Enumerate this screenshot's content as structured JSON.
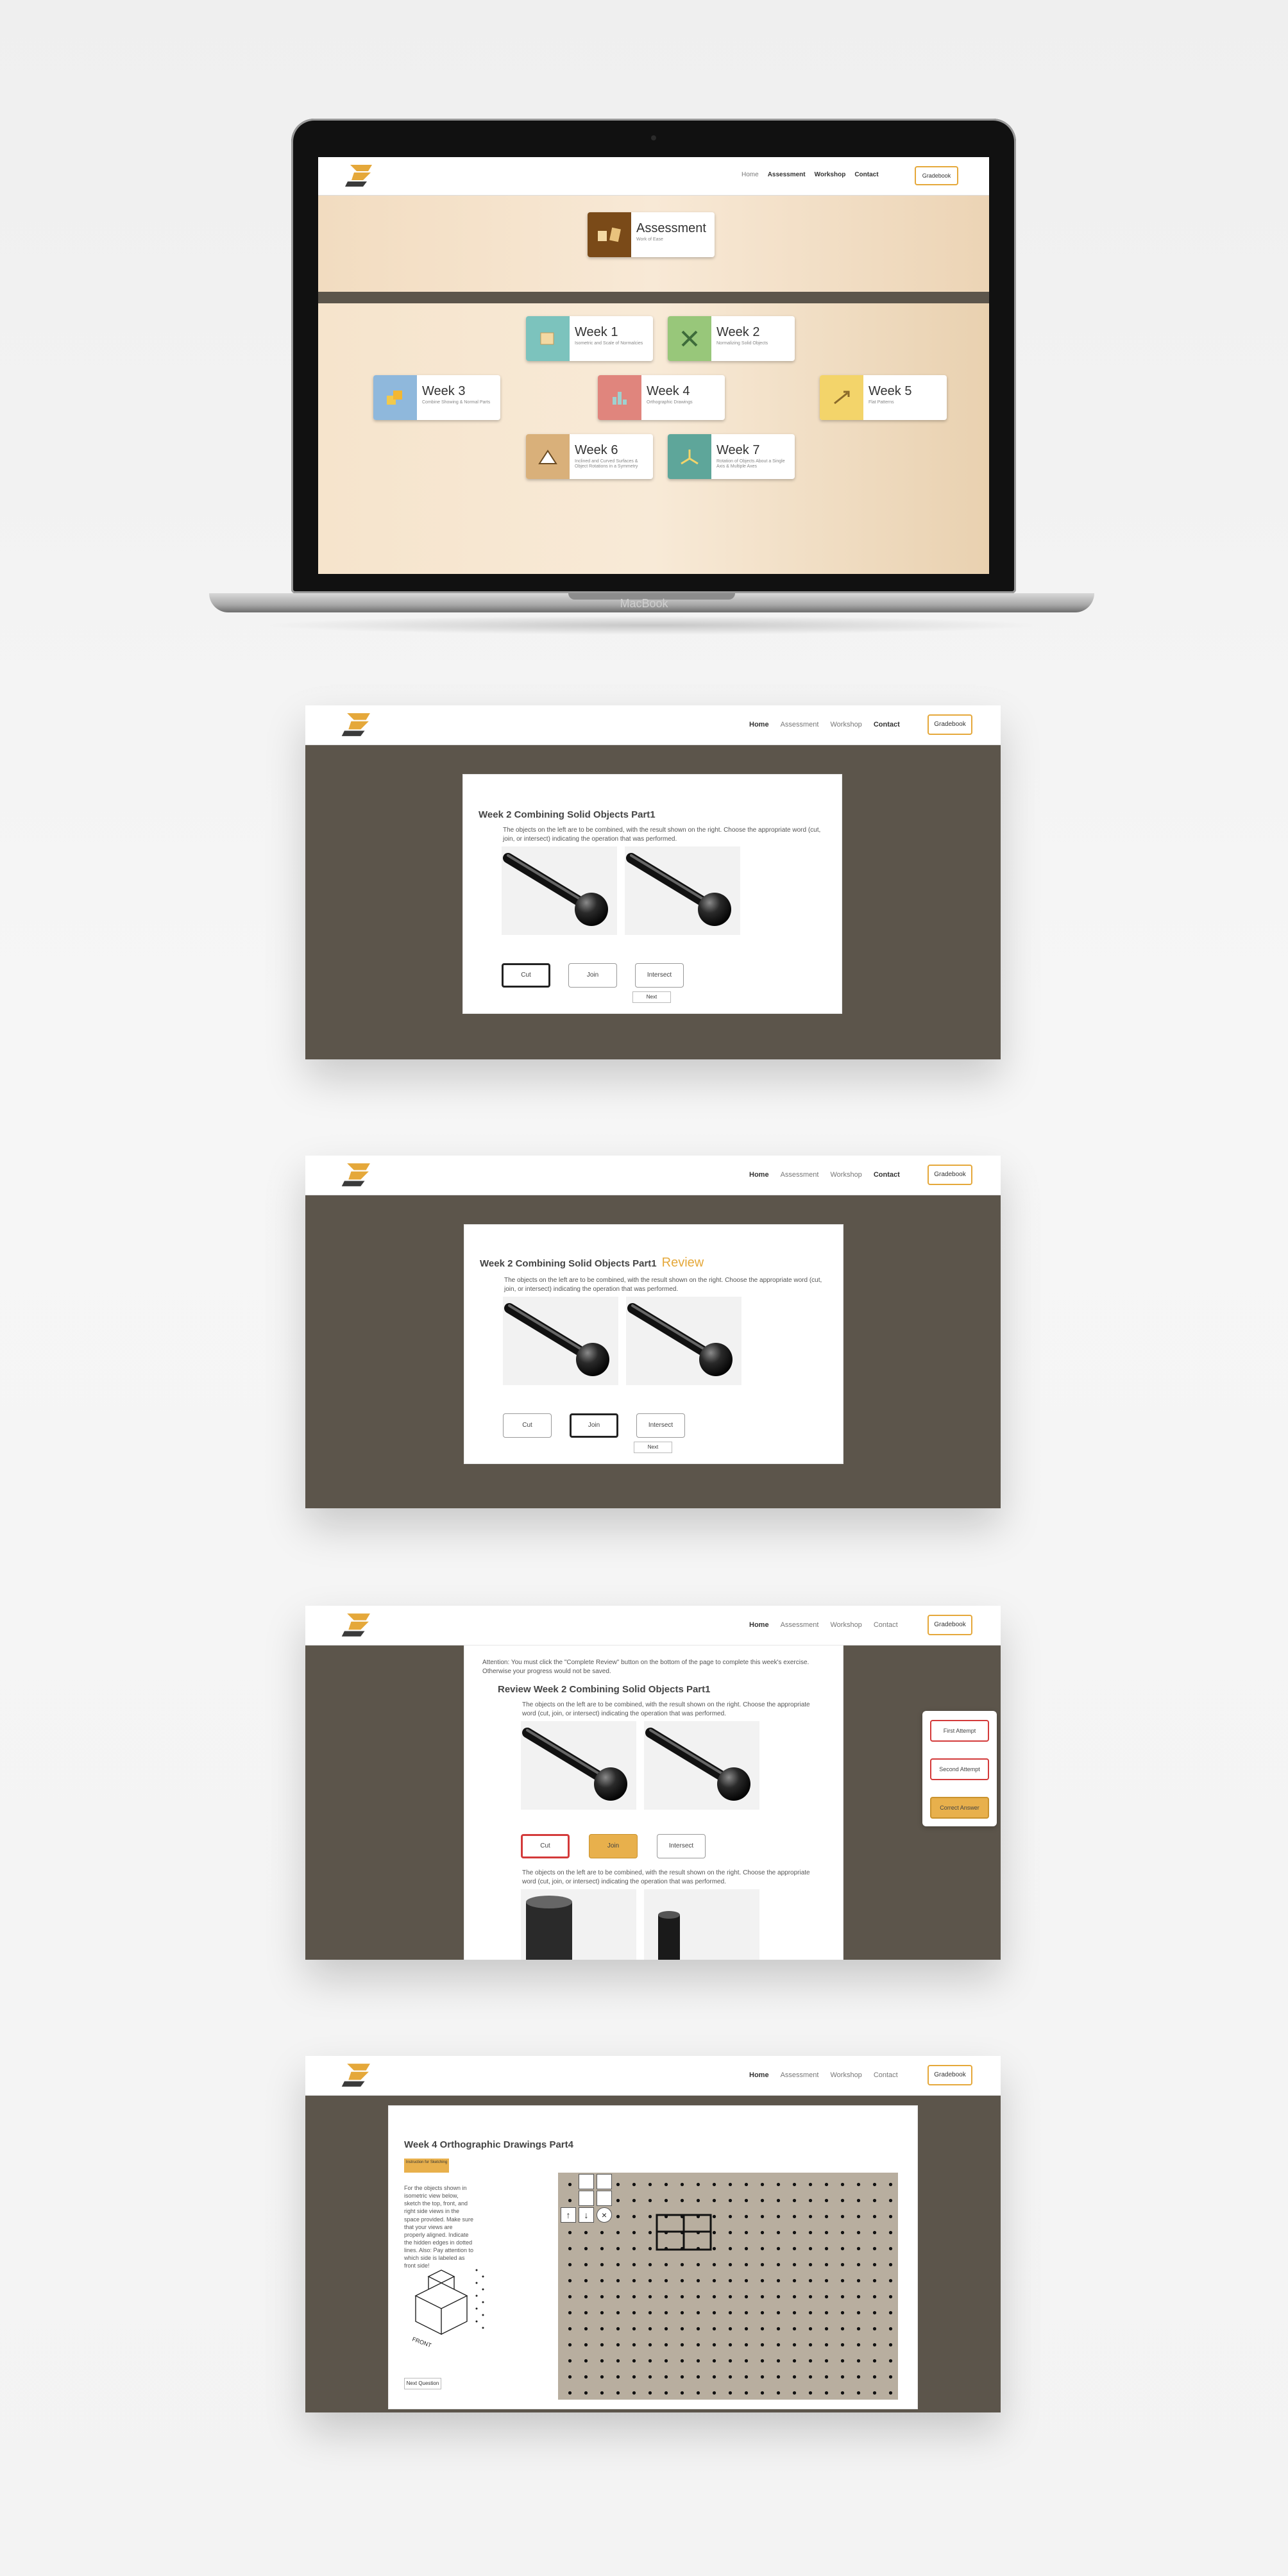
{
  "header": {
    "nav": [
      "Home",
      "Assessment",
      "Workshop",
      "Contact"
    ],
    "gradebook": "Gradebook"
  },
  "laptop": {
    "brand": "MacBook"
  },
  "home": {
    "assessment": {
      "title": "Assessment",
      "subtitle": "Work of Ease"
    },
    "weeks": [
      {
        "title": "Week 1",
        "subtitle": "Isometric and Scale of Normalcies",
        "color": "#7cc3bd",
        "icon": "cube-icon"
      },
      {
        "title": "Week 2",
        "subtitle": "Normalizing Solid Objects",
        "color": "#98c77a",
        "icon": "tools-icon"
      },
      {
        "title": "Week 3",
        "subtitle": "Combine Showing & Normal Parts",
        "color": "#8fb8dc",
        "icon": "blocks-icon"
      },
      {
        "title": "Week 4",
        "subtitle": "Orthographic Drawings",
        "color": "#e0857d",
        "icon": "bars-icon"
      },
      {
        "title": "Week 5",
        "subtitle": "Flat Patterns",
        "color": "#f3d46a",
        "icon": "arrow-icon"
      },
      {
        "title": "Week 6",
        "subtitle": "Inclined and Curved Surfaces & Object Rotations in a Symmetry",
        "color": "#d9b07a",
        "icon": "ramp-icon"
      },
      {
        "title": "Week 7",
        "subtitle": "Rotation of Objects About a Single Axis & Multiple Axes",
        "color": "#5ea69a",
        "icon": "axes-icon"
      }
    ]
  },
  "exercise": {
    "title": "Week 2 Combining Solid Objects Part1",
    "review_label": "Review",
    "text": "The objects on the left are to be combined, with the result shown on the right. Choose the appropriate word (cut, join, or intersect) indicating the operation that was performed.",
    "answers": [
      "Cut",
      "Join",
      "Intersect"
    ],
    "next": "Next"
  },
  "review": {
    "attention": "Attention: You must click the \"Complete Review\" button on the bottom of the page to complete this week's exercise. Otherwise your progress would not be saved.",
    "title": "Review Week 2 Combining Solid Objects Part1",
    "attempts": [
      "First Attempt",
      "Second Attempt",
      "Correct Answer"
    ]
  },
  "ortho": {
    "title": "Week 4 Orthographic Drawings Part4",
    "instructions_btn": "Instruction for Sketching",
    "text": "For the objects shown in isometric view below, sketch the top, front, and right side views in the space provided. Make sure that your views are properly aligned. Indicate the hidden edges in dotted lines. Also: Pay attention to which side is labeled as front side!",
    "front_label": "FRONT",
    "next_question": "Next Question"
  }
}
